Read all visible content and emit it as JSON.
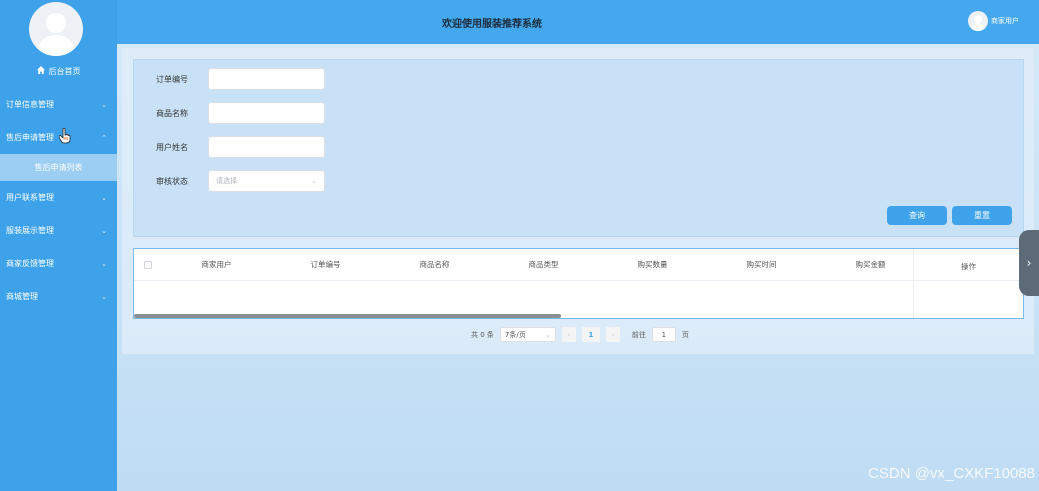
{
  "header": {
    "title": "欢迎使用服装推荐系统",
    "user_name": "商家用户"
  },
  "sidebar": {
    "home_label": "后台首页",
    "items": [
      {
        "label": "订单信息管理"
      },
      {
        "label": "售后申请管理",
        "sub": "售后申请列表"
      },
      {
        "label": "用户联系管理"
      },
      {
        "label": "服装展示管理"
      },
      {
        "label": "商家反馈管理"
      },
      {
        "label": "商城管理"
      }
    ]
  },
  "search": {
    "order_no_label": "订单编号",
    "product_name_label": "商品名称",
    "user_name_label": "用户姓名",
    "review_status_label": "审核状态",
    "review_status_placeholder": "请选择",
    "query_button": "查询",
    "reset_button": "重置"
  },
  "table": {
    "columns": [
      "商家用户",
      "订单编号",
      "商品名称",
      "商品类型",
      "购买数量",
      "购买时间",
      "购买金额"
    ],
    "operation_column": "操作"
  },
  "pagination": {
    "total_text": "共 0 条",
    "page_size": "7条/页",
    "current_page": "1",
    "goto_label": "前往",
    "goto_value": "1",
    "page_suffix": "页"
  },
  "watermark": "CSDN @vx_CXKF10088",
  "colors": {
    "sidebar_bg": "#3da2ea",
    "header_bg": "#43a8ee",
    "button_bg": "#3ea3eb"
  }
}
